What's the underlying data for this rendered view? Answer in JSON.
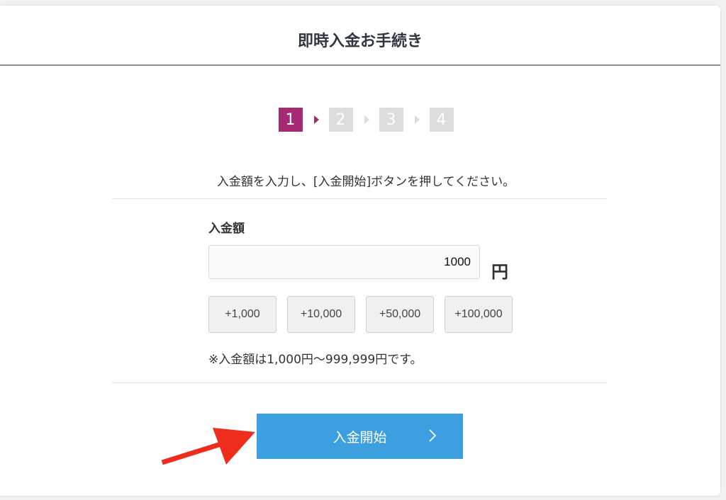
{
  "header": {
    "title": "即時入金お手続き"
  },
  "steps": [
    {
      "label": "1",
      "active": true
    },
    {
      "label": "2",
      "active": false
    },
    {
      "label": "3",
      "active": false
    },
    {
      "label": "4",
      "active": false
    }
  ],
  "instruction": "入金額を入力し、[入金開始]ボタンを押してください。",
  "amount": {
    "label": "入金額",
    "value": "1000",
    "unit": "円"
  },
  "quick_buttons": [
    "+1,000",
    "+10,000",
    "+50,000",
    "+100,000"
  ],
  "note": "※入金額は1,000円〜999,999円です。",
  "submit": {
    "label": "入金開始",
    "icon": "chevron-right-icon"
  },
  "annotation": {
    "icon": "red-arrow-icon",
    "color": "#ef2d1f"
  },
  "colors": {
    "step_active": "#a52a74",
    "step_inactive": "#dddddd",
    "button_primary": "#3d9ee0"
  }
}
